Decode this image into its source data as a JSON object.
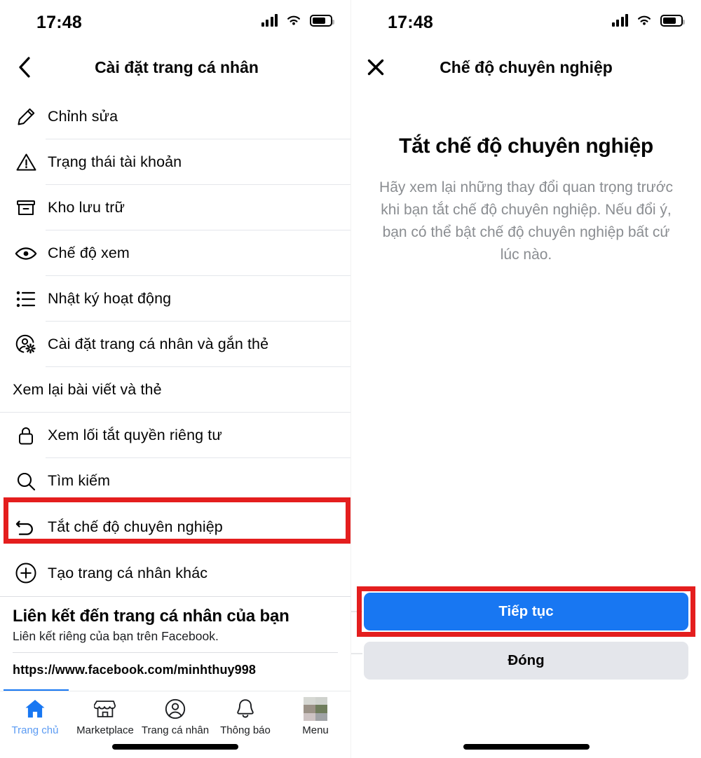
{
  "status_bar": {
    "time": "17:48",
    "signal_icon": "cellular-signal-icon",
    "wifi_icon": "wifi-icon",
    "battery_icon": "battery-icon"
  },
  "left_screen": {
    "nav": {
      "back_icon": "chevron-left-icon",
      "title": "Cài đặt trang cá nhân"
    },
    "items": [
      {
        "icon": "pencil-icon",
        "label": "Chỉnh sửa"
      },
      {
        "icon": "warning-triangle-icon",
        "label": "Trạng thái tài khoản"
      },
      {
        "icon": "archive-box-icon",
        "label": "Kho lưu trữ"
      },
      {
        "icon": "eye-icon",
        "label": "Chế độ xem"
      },
      {
        "icon": "list-icon",
        "label": "Nhật ký hoạt động"
      },
      {
        "icon": "profile-gear-icon",
        "label": "Cài đặt trang cá nhân và gắn thẻ"
      },
      {
        "icon": "none",
        "label": "Xem lại bài viết và thẻ"
      },
      {
        "icon": "lock-icon",
        "label": "Xem lối tắt quyền riêng tư"
      },
      {
        "icon": "search-icon",
        "label": "Tìm kiếm"
      },
      {
        "icon": "undo-arrow-icon",
        "label": "Tắt chế độ chuyên nghiệp",
        "highlighted": true
      },
      {
        "icon": "plus-circle-icon",
        "label": "Tạo trang cá nhân khác"
      }
    ],
    "link_section": {
      "title": "Liên kết đến trang cá nhân của bạn",
      "subtitle": "Liên kết riêng của bạn trên Facebook.",
      "url": "https://www.facebook.com/minhthuy998"
    },
    "tabs": [
      {
        "icon": "home-icon",
        "label": "Trang chủ",
        "active": true
      },
      {
        "icon": "marketplace-icon",
        "label": "Marketplace",
        "active": false
      },
      {
        "icon": "profile-icon",
        "label": "Trang cá nhân",
        "active": false
      },
      {
        "icon": "bell-icon",
        "label": "Thông báo",
        "active": false
      },
      {
        "icon": "avatar-menu-icon",
        "label": "Menu",
        "active": false
      }
    ]
  },
  "right_screen": {
    "nav": {
      "close_icon": "close-x-icon",
      "title": "Chế độ chuyên nghiệp"
    },
    "heading": "Tắt chế độ chuyên nghiệp",
    "body": "Hãy xem lại những thay đổi quan trọng trước khi bạn tắt chế độ chuyên nghiệp. Nếu đổi ý, bạn có thể bật chế độ chuyên nghiệp bất cứ lúc nào.",
    "primary_button": "Tiếp tục",
    "secondary_button": "Đóng"
  },
  "colors": {
    "accent_blue": "#1877f2",
    "highlight_red": "#e41e1e",
    "muted_text": "#8a8d91",
    "divider": "#e4e6eb",
    "secondary_button_bg": "#e4e6eb"
  }
}
